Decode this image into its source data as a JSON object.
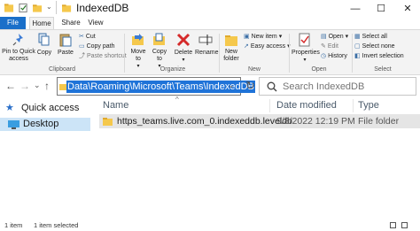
{
  "window": {
    "title": "IndexedDB",
    "minimize_glyph": "—",
    "maximize_glyph": "☐",
    "close_glyph": "✕",
    "qa_toolbar_arrow": "⌄"
  },
  "ribbon": {
    "tabs": {
      "file": "File",
      "home": "Home",
      "share": "Share",
      "view": "View"
    },
    "clipboard": {
      "pin_to_quick_access": "Pin to Quick access",
      "copy": "Copy",
      "paste": "Paste",
      "cut": "Cut",
      "copy_path": "Copy path",
      "paste_shortcut": "Paste shortcut",
      "group_label": "Clipboard"
    },
    "organize": {
      "move_to": "Move to",
      "copy_to": "Copy to",
      "delete": "Delete",
      "rename": "Rename",
      "group_label": "Organize"
    },
    "new": {
      "new_folder": "New folder",
      "new_item": "New item",
      "easy_access": "Easy access",
      "group_label": "New"
    },
    "open": {
      "properties": "Properties",
      "open": "Open",
      "edit": "Edit",
      "history": "History",
      "group_label": "Open"
    },
    "select": {
      "select_all": "Select all",
      "select_none": "Select none",
      "invert_selection": "Invert selection",
      "group_label": "Select"
    }
  },
  "navigation": {
    "back": "←",
    "forward": "→",
    "recent": "⌄",
    "up": "↑",
    "address_path": "Data\\Roaming\\Microsoft\\Teams\\IndexedDB",
    "address_dropdown": "⌄",
    "refresh": "↻",
    "search_placeholder": "Search IndexedDB"
  },
  "sidebar": {
    "items": [
      {
        "label": "Quick access"
      },
      {
        "label": "Desktop"
      }
    ]
  },
  "file_list": {
    "columns": [
      "Name",
      "Date modified",
      "Type"
    ],
    "sort_arrow": "^",
    "rows": [
      {
        "name": "https_teams.live.com_0.indexeddb.leveldb",
        "date_modified": "9/8/2022 12:19 PM",
        "type": "File folder"
      }
    ]
  },
  "status_bar": {
    "item_count": "1 item",
    "selected": "1 item selected"
  },
  "colors": {
    "accent": "#1a6fc9",
    "folder": "#f5c84c",
    "selection": "#cce4f7",
    "address_highlight": "#1f73d8"
  }
}
